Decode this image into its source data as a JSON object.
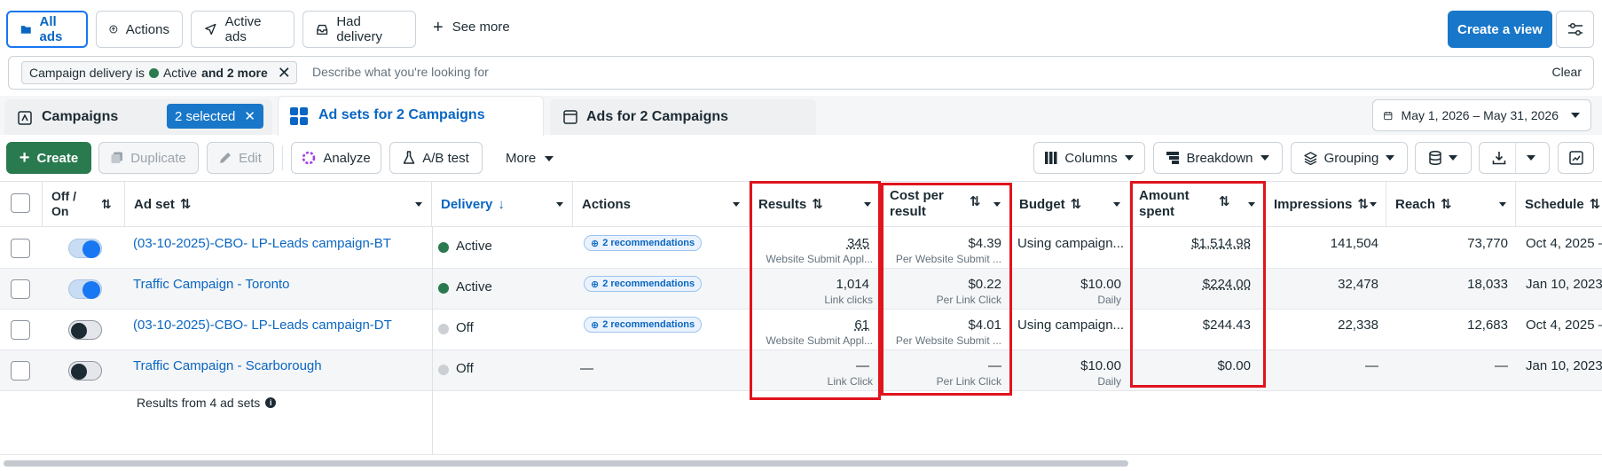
{
  "top_tabs": [
    {
      "label": "All ads",
      "icon": "folder-icon",
      "active": true
    },
    {
      "label": "Actions",
      "icon": "actions-icon"
    },
    {
      "label": "Active ads",
      "icon": "send-icon"
    },
    {
      "label": "Had delivery",
      "icon": "inbox-icon"
    }
  ],
  "see_more_label": "See more",
  "create_view_label": "Create a view",
  "filter": {
    "chip_prefix": "Campaign delivery is",
    "chip_status": "Active",
    "chip_more": "and 2 more",
    "placeholder": "Describe what you're looking for",
    "clear_label": "Clear"
  },
  "level_tabs": {
    "campaigns_label": "Campaigns",
    "selected_label": "2 selected",
    "adsets_label": "Ad sets for 2 Campaigns",
    "ads_label": "Ads for 2 Campaigns"
  },
  "date_range": "May 1, 2026 – May 31, 2026",
  "toolbar": {
    "create": "Create",
    "duplicate": "Duplicate",
    "edit": "Edit",
    "analyze": "Analyze",
    "ab_test": "A/B test",
    "more": "More",
    "columns": "Columns",
    "breakdown": "Breakdown",
    "grouping": "Grouping"
  },
  "columns": {
    "off_on": "Off / On",
    "ad_set": "Ad set",
    "delivery": "Delivery",
    "actions": "Actions",
    "results": "Results",
    "cost_per_result_1": "Cost per",
    "cost_per_result_2": "result",
    "budget": "Budget",
    "amount_spent_1": "Amount",
    "amount_spent_2": "spent",
    "impressions": "Impressions",
    "reach": "Reach",
    "schedule": "Schedule"
  },
  "rows": [
    {
      "name": "(03-10-2025)-CBO- LP-Leads campaign-BT",
      "toggle": "on",
      "delivery": "Active",
      "delivery_color": "#2a7a4f",
      "actions": "2 recommendations",
      "results": "345",
      "results_sub": "Website Submit Appl...",
      "cost": "$4.39",
      "cost_sub": "Per Website Submit ...",
      "budget": "Using campaign...",
      "budget_sub": "",
      "spent": "$1,514.98",
      "impressions": "141,504",
      "reach": "73,770",
      "schedule": "Oct 4, 2025 –"
    },
    {
      "name": "Traffic Campaign - Toronto",
      "toggle": "on",
      "delivery": "Active",
      "delivery_color": "#2a7a4f",
      "actions": "2 recommendations",
      "results": "1,014",
      "results_sub": "Link clicks",
      "cost": "$0.22",
      "cost_sub": "Per Link Click",
      "budget": "$10.00",
      "budget_sub": "Daily",
      "spent": "$224.00",
      "impressions": "32,478",
      "reach": "18,033",
      "schedule": "Jan 10, 2023"
    },
    {
      "name": "(03-10-2025)-CBO- LP-Leads campaign-DT",
      "toggle": "off",
      "delivery": "Off",
      "delivery_color": "#ccd0d5",
      "actions": "2 recommendations",
      "results": "61",
      "results_sub": "Website Submit Appl...",
      "cost": "$4.01",
      "cost_sub": "Per Website Submit ...",
      "budget": "Using campaign...",
      "budget_sub": "",
      "spent": "$244.43",
      "impressions": "22,338",
      "reach": "12,683",
      "schedule": "Oct 4, 2025 –"
    },
    {
      "name": "Traffic Campaign - Scarborough",
      "toggle": "off",
      "delivery": "Off",
      "delivery_color": "#ccd0d5",
      "actions": "—",
      "results": "—",
      "results_sub": "Link Click",
      "cost": "—",
      "cost_sub": "Per Link Click",
      "budget": "$10.00",
      "budget_sub": "Daily",
      "spent": "$0.00",
      "impressions": "—",
      "reach": "—",
      "schedule": "Jan 10, 2023"
    }
  ],
  "footer_text": "Results from 4 ad sets",
  "highlight_color": "#e0141e"
}
